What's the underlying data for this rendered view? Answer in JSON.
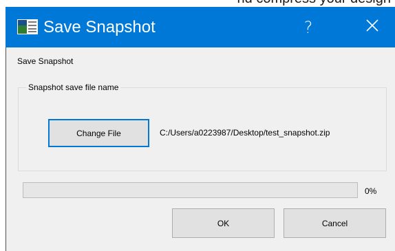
{
  "background_strip": {
    "text": "nd compress your design"
  },
  "dialog": {
    "title": "Save Snapshot",
    "help_glyph": "?",
    "close_glyph": "×",
    "heading": "Save Snapshot",
    "group": {
      "legend": "Snapshot save file name",
      "change_file_label": "Change File",
      "file_path": "C:/Users/a0223987/Desktop/test_snapshot.zip"
    },
    "progress": {
      "value_percent": 0,
      "label": "0%"
    },
    "ok_label": "OK",
    "cancel_label": "Cancel"
  },
  "icons": {
    "app": "window-app-icon",
    "help": "help-icon",
    "close": "close-icon"
  },
  "colors": {
    "titlebar": "#0078d7",
    "dialog_bg": "#f0f0f0",
    "button_bg": "#e1e1e1",
    "focus_border": "#0078d7"
  }
}
